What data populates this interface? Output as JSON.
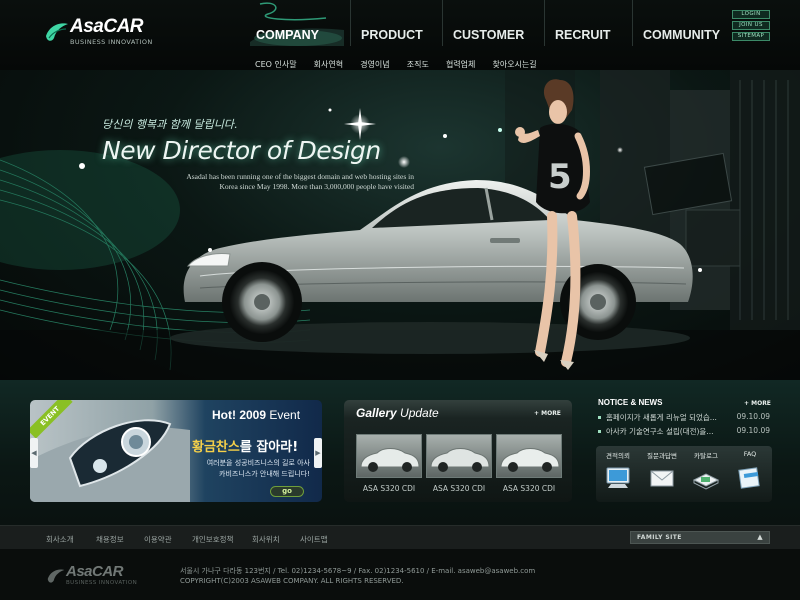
{
  "brand": {
    "name": "AsaCAR",
    "tagline": "BUSINESS INNOVATION"
  },
  "gnb": {
    "items": [
      {
        "label": "COMPANY"
      },
      {
        "label": "PRODUCT"
      },
      {
        "label": "CUSTOMER"
      },
      {
        "label": "RECRUIT"
      },
      {
        "label": "COMMUNITY"
      }
    ]
  },
  "sub_nav": {
    "items": [
      "CEO 인사말",
      "회사연혁",
      "경영이념",
      "조직도",
      "협력업체",
      "찾아오시는길"
    ]
  },
  "util": {
    "login": "LOGIN",
    "join": "JOIN US",
    "sitemap": "SITEMAP"
  },
  "hero": {
    "korean_line": "당신의 행복과 함께 달립니다.",
    "title": "New Director of Design",
    "description": "Asadal has been running one of the biggest domain and web hosting sites in Korea since May 1998. More than 3,000,000 people have visited",
    "shirt_number": "5"
  },
  "event": {
    "ribbon": "EVENT",
    "title_strong": "Hot! 2009",
    "title_rest": " Event",
    "headline_highlight": "황금찬스",
    "headline_rest": "를 잡아라!",
    "text": "여러분을 성공비즈니스의 길로 아사카비즈니스가 안내해 드립니다!",
    "go_label": "go",
    "prev": "◀",
    "next": "▶"
  },
  "gallery": {
    "title_strong": "Gallery",
    "title_rest": " Update",
    "more_label": "+ MORE",
    "items": [
      {
        "caption": "ASA S320 CDI"
      },
      {
        "caption": "ASA S320 CDI"
      },
      {
        "caption": "ASA S320 CDI"
      }
    ]
  },
  "notice": {
    "title": "NOTICE & NEWS",
    "more_label": "+ MORE",
    "items": [
      {
        "title": "홈페이지가 새롭게 리뉴얼 되었습...",
        "date": "09.10.09"
      },
      {
        "title": "아사카 기술연구소 설립(대전)을...",
        "date": "09.10.09"
      }
    ]
  },
  "quick": {
    "items": [
      {
        "label": "견적의뢰",
        "icon": "monitor-icon"
      },
      {
        "label": "질문과답변",
        "icon": "mail-icon"
      },
      {
        "label": "카탈로그",
        "icon": "catalog-icon"
      },
      {
        "label": "FAQ",
        "icon": "faq-icon"
      }
    ]
  },
  "footer": {
    "links": [
      "회사소개",
      "채용정보",
      "이용약관",
      "개인보호정책",
      "회사위치",
      "사이트맵"
    ],
    "family_site": "FAMILY SITE",
    "family_caret": "▲",
    "address": "서울시 가나구 다라동 123번지  /  Tel. 02)1234-5678~9  /  Fax. 02)1234-5610  /  E-mail. asaweb@asaweb.com",
    "copyright": "COPYRIGHT(C)2003 ASAWEB COMPANY. ALL RIGHTS RESERVED."
  },
  "colors": {
    "accent": "#3fd6a4",
    "background": "#050807",
    "ribbon": "#8ac024",
    "highlight": "#f6d049"
  }
}
